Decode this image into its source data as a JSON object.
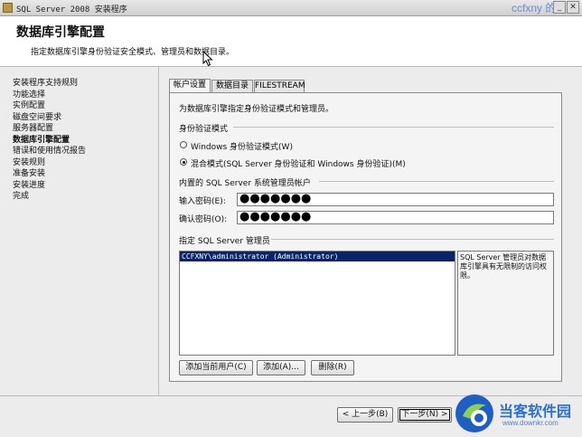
{
  "window": {
    "title": "SQL Server 2008 安装程序",
    "watermark": "ccfxny 的"
  },
  "header": {
    "title": "数据库引擎配置",
    "description": "指定数据库引擎身份验证安全模式、管理员和数据目录。"
  },
  "sidebar": {
    "items": [
      {
        "label": "安装程序支持规则",
        "active": false
      },
      {
        "label": "功能选择",
        "active": false
      },
      {
        "label": "实例配置",
        "active": false
      },
      {
        "label": "磁盘空间要求",
        "active": false
      },
      {
        "label": "服务器配置",
        "active": false
      },
      {
        "label": "数据库引擎配置",
        "active": true
      },
      {
        "label": "错误和使用情况报告",
        "active": false
      },
      {
        "label": "安装规则",
        "active": false
      },
      {
        "label": "准备安装",
        "active": false
      },
      {
        "label": "安装进度",
        "active": false
      },
      {
        "label": "完成",
        "active": false
      }
    ]
  },
  "tabs": [
    {
      "label": "帐户设置",
      "active": true
    },
    {
      "label": "数据目录",
      "active": false
    },
    {
      "label": "FILESTREAM",
      "active": false
    }
  ],
  "account": {
    "intro": "为数据库引擎指定身份验证模式和管理员。",
    "auth_mode_label": "身份验证模式",
    "windows_mode_label": "Windows 身份验证模式(W)",
    "mixed_mode_label": "混合模式(SQL Server 身份验证和 Windows 身份验证)(M)",
    "selected_mode": "mixed",
    "sa_group_label": "内置的 SQL Server 系统管理员帐户",
    "password_label": "输入密码(E):",
    "password_value": "●●●●●●●",
    "confirm_label": "确认密码(O):",
    "confirm_value": "●●●●●●●",
    "admins_label": "指定 SQL Server 管理员",
    "admins": [
      "CCFXNY\\administrator (Administrator)"
    ],
    "admins_info": "SQL Server 管理员对数据库引擎具有无限制的访问权限。",
    "add_current_user_label": "添加当前用户(C)",
    "add_label": "添加(A)...",
    "remove_label": "删除(R)"
  },
  "nav": {
    "back_label": "< 上一步(B)",
    "next_label": "下一步(N) >"
  },
  "branding": {
    "logo_text": "当客软件园",
    "logo_url": "www.downkr.com"
  },
  "colors": {
    "selection": "#0a246a",
    "logo": "#2a6fd0"
  }
}
